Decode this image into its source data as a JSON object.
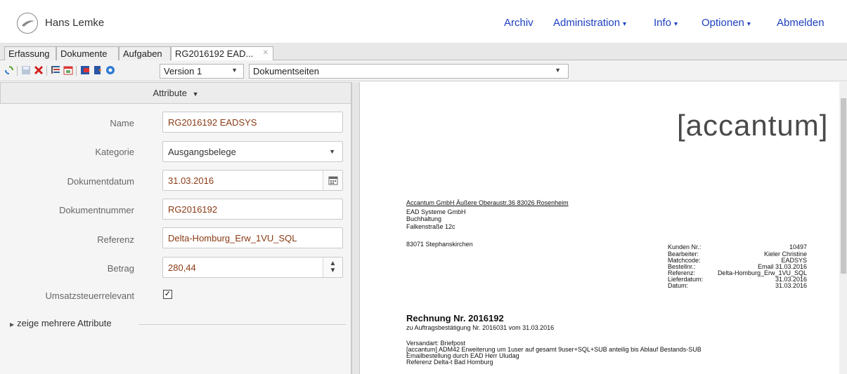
{
  "header": {
    "user": "Hans Lemke",
    "nav": [
      {
        "label": "Archiv",
        "caret": ""
      },
      {
        "label": "Administration",
        "caret": "▾"
      },
      {
        "label": "Info",
        "caret": "▾"
      },
      {
        "label": "Optionen",
        "caret": "▾"
      },
      {
        "label": "Abmelden",
        "caret": ""
      }
    ],
    "accent": "#1d3fbf"
  },
  "tabs": [
    "Erfassung",
    "Dokumente",
    "Aufgaben",
    "RG2016192 EAD..."
  ],
  "toolbar": {
    "version": "Version 1",
    "pages": "Dokumentseiten",
    "icons": [
      "refresh-icon",
      "save-icon",
      "delete-icon",
      "tree-icon",
      "calendar-icon",
      "export-icon",
      "print-icon",
      "settings-icon"
    ]
  },
  "attributes": {
    "header": "Attribute",
    "fields": [
      {
        "label": "Name",
        "value": "RG2016192 EADSYS"
      },
      {
        "label": "Kategorie",
        "value": "Ausgangsbelege"
      },
      {
        "label": "Dokumentdatum",
        "value": "31.03.2016"
      },
      {
        "label": "Dokumentnummer",
        "value": "RG2016192"
      },
      {
        "label": "Referenz",
        "value": "Delta-Homburg_Erw_1VU_SQL"
      },
      {
        "label": "Betrag",
        "value": "280,44"
      }
    ],
    "vat_label": "Umsatzsteuerrelevant",
    "vat_checked": true,
    "more": "zeige mehrere Attribute"
  },
  "document": {
    "logo": "[accantum]",
    "sender": "Accantum GmbH Äußere Oberaustr.36 83026 Rosenheim",
    "recipient": [
      "EAD Systeme GmbH",
      "Buchhaltung",
      "Falkenstraße 12c",
      "83071 Stephanskirchen"
    ],
    "info_labels": [
      "Kunden Nr.:",
      "Bearbeiter:",
      "Matchcode:",
      "Bestellnr.:",
      "Referenz:",
      "Lieferdatum:",
      "Datum:"
    ],
    "info_values": [
      "10497",
      "Kieler Christine",
      "EADSYS",
      "Email 31.03.2016",
      "Delta-Homburg_Erw_1VU_SQL",
      "31.03.2016",
      "31.03.2016"
    ],
    "title": "Rechnung Nr. 2016192",
    "subtitle": "zu Auftragsbestätigung Nr. 2016031 vom 31.03.2016",
    "body": [
      "Versandart: Briefpost",
      "[accantum] ADM42 Erweiterung um 1user auf gesamt 9user+SQL+SUB anteilig bis Ablauf Bestands-SUB",
      "Emailbestellung durch EAD Herr Uludag",
      "Referenz Delta-t Bad Homburg"
    ]
  }
}
